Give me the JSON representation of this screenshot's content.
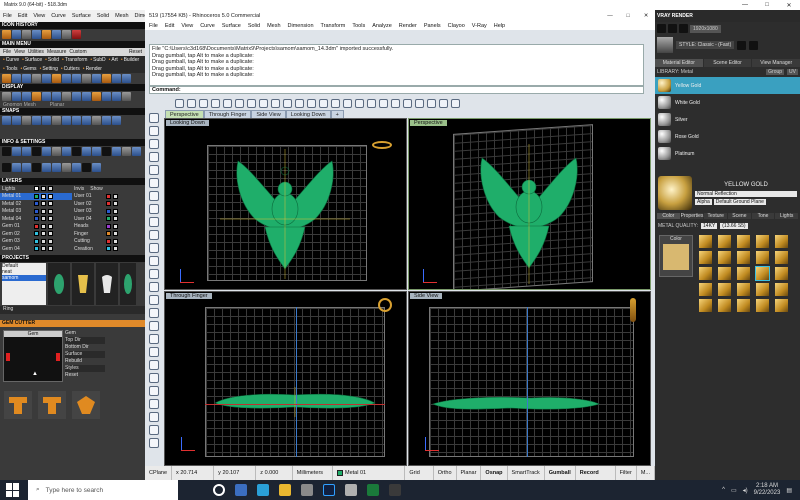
{
  "os_title": "Matrix 9.0 (64-bit) - 518.3dm",
  "os_window_controls": [
    "—",
    "□",
    "✕"
  ],
  "matrix_menu": [
    "File",
    "Edit",
    "View",
    "Curve",
    "Surface",
    "Solid",
    "Mesh",
    "Dimension",
    "Transform",
    "Analyze",
    "Render",
    "Rhino 5.0",
    "Blend",
    "Clayoo",
    "Help"
  ],
  "left": {
    "icon_history": "ICON HISTORY",
    "main_menu": "MAIN MENU",
    "main_menu_items_row1": [
      "File",
      "View",
      "Utilities",
      "Measure",
      "Custom"
    ],
    "main_menu_reset": "Reset",
    "main_menu_items": [
      "Curve",
      "Surface",
      "Solid",
      "Transform",
      "SubD",
      "Art",
      "Builder",
      "Tools",
      "Gems",
      "Setting",
      "Cutters",
      "Render"
    ],
    "display": "DISPLAY",
    "display_modes": [
      "Gnomon Mesh",
      "Planar"
    ],
    "snaps": "SNAPS",
    "info": "INFO & SETTINGS",
    "layers": "LAYERS",
    "layers_col1": [
      "Lights",
      "Metal 01",
      "Metal 02",
      "Metal 03",
      "Metal 04",
      "Gem 01",
      "Gem 02",
      "Gem 03",
      "Gem 04"
    ],
    "layers_col2_head": [
      "Invis",
      "Show"
    ],
    "layers_col2": [
      "User 01",
      "User 02",
      "User 03",
      "User 04",
      "Heads",
      "Finger",
      "Cutting",
      "Creation"
    ],
    "projects": "PROJECTS",
    "projects_list": [
      "Default",
      "neat",
      "samom"
    ],
    "ring_label": "Ring",
    "gem_cutter": "GEM CUTTER",
    "gem_label": "Gem",
    "gem_options": [
      "Gem",
      "Top Dir",
      "Bottom Dir",
      "Surface",
      "Rebuild",
      "Styles",
      "Reset"
    ]
  },
  "app": {
    "title": "519 (17554 KB) - Rhinoceros 5.0 Commercial",
    "controls": [
      "—",
      "□",
      "✕"
    ],
    "menu": [
      "File",
      "Edit",
      "View",
      "Curve",
      "Surface",
      "Solid",
      "Mesh",
      "Dimension",
      "Transform",
      "Tools",
      "Analyze",
      "Render",
      "Panels",
      "Clayoo",
      "V-Ray",
      "Help"
    ],
    "history": [
      "File \"C:\\Users\\c3d168\\Documents\\Matrix9\\Projects\\samom\\samom_14.3dm\" imported successfully.",
      "Drag gumball, tap Alt to make a duplicate:",
      "Drag gumball, tap Alt to make a duplicate:",
      "Drag gumball, tap Alt to make a duplicate:",
      "Drag gumball, tap Alt to make a duplicate:"
    ],
    "command": "Command:",
    "tabs": [
      "Perspective",
      "Through Finger",
      "Side View",
      "Looking Down",
      "+"
    ],
    "viewports": [
      "Looking Down",
      "Perspective",
      "Through Finger",
      "Side View"
    ],
    "status": {
      "cplane": "CPlane",
      "x": "x 20.714",
      "y": "y 20.107",
      "z": "z 0.000",
      "units": "Millimeters",
      "layer": "Metal 01",
      "toggles": [
        "Grid Snap",
        "Ortho",
        "Planar",
        "Osnap",
        "SmartTrack",
        "Gumball",
        "Record History",
        "Filter",
        "M..."
      ]
    }
  },
  "right": {
    "title": "VRAY RENDER",
    "resolution": "1920x1080",
    "style": "STYLE: Classic - (Fast)",
    "tabs": [
      "Material Editor",
      "Scene Editor",
      "View Manager"
    ],
    "library": "LIBRARY: Metal",
    "library_controls": [
      "Group",
      "UV"
    ],
    "materials": [
      "Yellow Gold",
      "White Gold",
      "Silver",
      "Rose Gold",
      "Platinum"
    ],
    "selected_material": "YELLOW GOLD",
    "reflection": "Normal Reflection",
    "alpha": "Alpha",
    "alpha_value": "Default Ground Plane",
    "bottom_tabs": [
      "Color",
      "Properties",
      "Texture",
      "Scene",
      "Tone",
      "Lights"
    ],
    "metal_quality": "METAL QUALITY:",
    "metal_quality_value": "14KY",
    "metal_quality_extra": "(13.66 S5)",
    "color_label": "Color"
  },
  "taskbar": {
    "search": "Type here to search",
    "time": "2:18 AM",
    "date": "9/22/2023"
  }
}
